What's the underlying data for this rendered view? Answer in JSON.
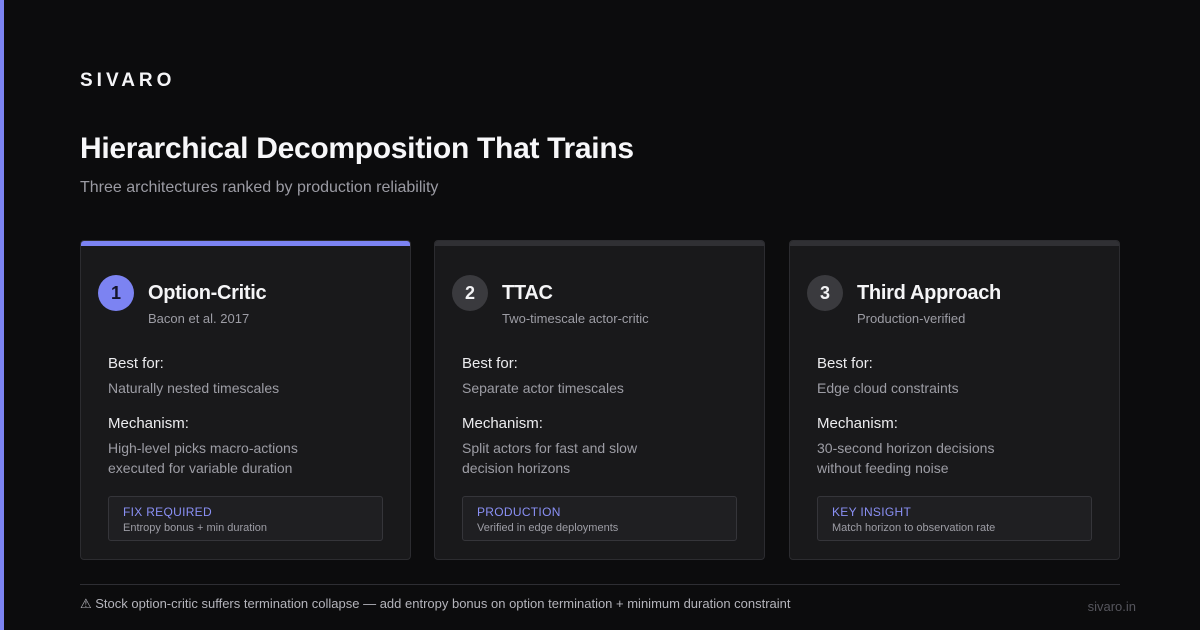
{
  "brand": "SIVARO",
  "header": {
    "title": "Hierarchical Decomposition That Trains",
    "subtitle": "Three architectures ranked by production reliability"
  },
  "cards": [
    {
      "number": "1",
      "name": "Option-Critic",
      "subtitle": "Bacon et al. 2017",
      "best_label": "Best for:",
      "best_value": "Naturally nested timescales",
      "mech_label": "Mechanism:",
      "mech_line1": "High-level picks macro-actions",
      "mech_line2": "executed for variable duration",
      "tag_title": "FIX REQUIRED",
      "tag_text": "Entropy bonus + min duration"
    },
    {
      "number": "2",
      "name": "TTAC",
      "subtitle": "Two-timescale actor-critic",
      "best_label": "Best for:",
      "best_value": "Separate actor timescales",
      "mech_label": "Mechanism:",
      "mech_line1": "Split actors for fast and slow",
      "mech_line2": "decision horizons",
      "tag_title": "PRODUCTION",
      "tag_text": "Verified in edge deployments"
    },
    {
      "number": "3",
      "name": "Third Approach",
      "subtitle": "Production-verified",
      "best_label": "Best for:",
      "best_value": "Edge cloud constraints",
      "mech_label": "Mechanism:",
      "mech_line1": "30-second horizon decisions",
      "mech_line2": "without feeding noise",
      "tag_title": "KEY INSIGHT",
      "tag_text": "Match horizon to observation rate"
    }
  ],
  "footer": {
    "note": "⚠ Stock option-critic suffers termination collapse — add entropy bonus on option termination + minimum duration constraint",
    "site": "sivaro.in"
  },
  "colors": {
    "accent": "#7c83f2",
    "background": "#0c0c0d",
    "card": "#19191b"
  }
}
